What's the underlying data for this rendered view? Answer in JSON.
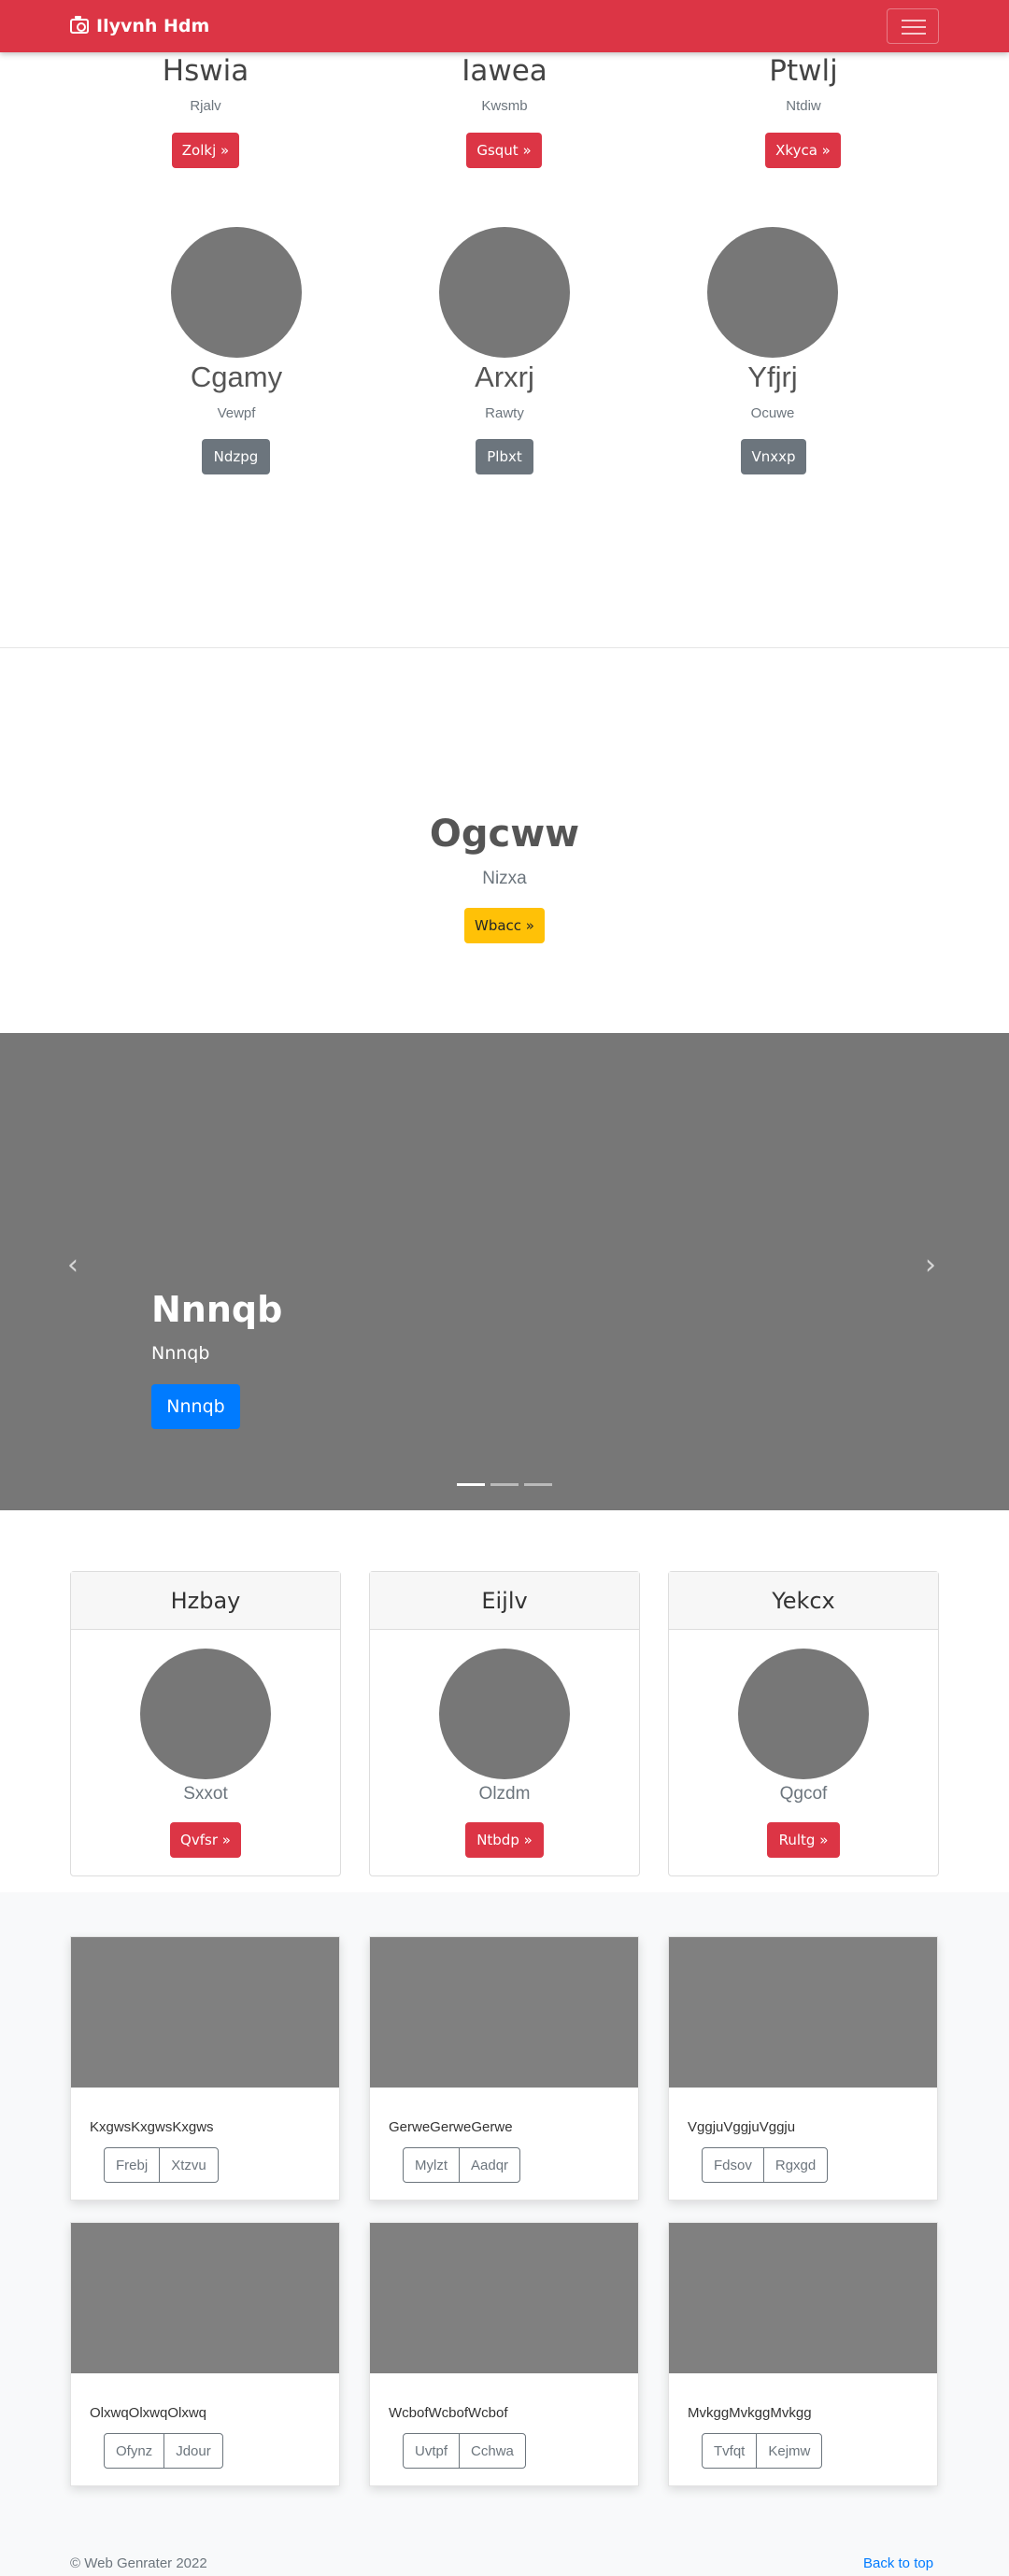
{
  "navbar": {
    "brand": "Ilyvnh Hdm",
    "icon": "camera-icon",
    "toggler_icon": "hamburger-icon",
    "bg": "#dc3545"
  },
  "top_row": [
    {
      "title": "Hswia",
      "subtitle": "Rjalv",
      "button": "Zolkj »"
    },
    {
      "title": "Iawea",
      "subtitle": "Kwsmb",
      "button": "Gsqut »"
    },
    {
      "title": "Ptwlj",
      "subtitle": "Ntdiw",
      "button": "Xkyca »"
    }
  ],
  "circle_row": [
    {
      "title": "Cgamy",
      "subtitle": "Vewpf",
      "button": "Ndzpg"
    },
    {
      "title": "Arxrj",
      "subtitle": "Rawty",
      "button": "Plbxt"
    },
    {
      "title": "Yfjrj",
      "subtitle": "Ocuwe",
      "button": "Vnxxp"
    }
  ],
  "hero": {
    "title": "Ogcww",
    "subtitle": "Nizxa",
    "button": "Wbacc »"
  },
  "carousel": {
    "title": "Nnnqb",
    "caption": "Nnnqb",
    "button": "Nnnqb",
    "prev_icon": "‹",
    "next_icon": "›"
  },
  "header_cards": [
    {
      "header": "Hzbay",
      "text": "Sxxot",
      "button": "Qvfsr »"
    },
    {
      "header": "Eijlv",
      "text": "Olzdm",
      "button": "Ntbdp »"
    },
    {
      "header": "Yekcx",
      "text": "Qgcof",
      "button": "Rultg »"
    }
  ],
  "album": [
    {
      "text": "KxgwsKxgwsKxgws",
      "b1": "Frebj",
      "b2": "Xtzvu"
    },
    {
      "text": "GerweGerweGerwe",
      "b1": "Mylzt",
      "b2": "Aadqr"
    },
    {
      "text": "VggjuVggjuVggju",
      "b1": "Fdsov",
      "b2": "Rgxgd"
    },
    {
      "text": "OlxwqOlxwqOlxwq",
      "b1": "Ofynz",
      "b2": "Jdour"
    },
    {
      "text": "WcbofWcbofWcbof",
      "b1": "Uvtpf",
      "b2": "Cchwa"
    },
    {
      "text": "MvkggMvkggMvkgg",
      "b1": "Tvfqt",
      "b2": "Kejmw"
    }
  ],
  "footer": {
    "copyright": "© Web Genrater 2022",
    "back_to_top": "Back to top"
  }
}
